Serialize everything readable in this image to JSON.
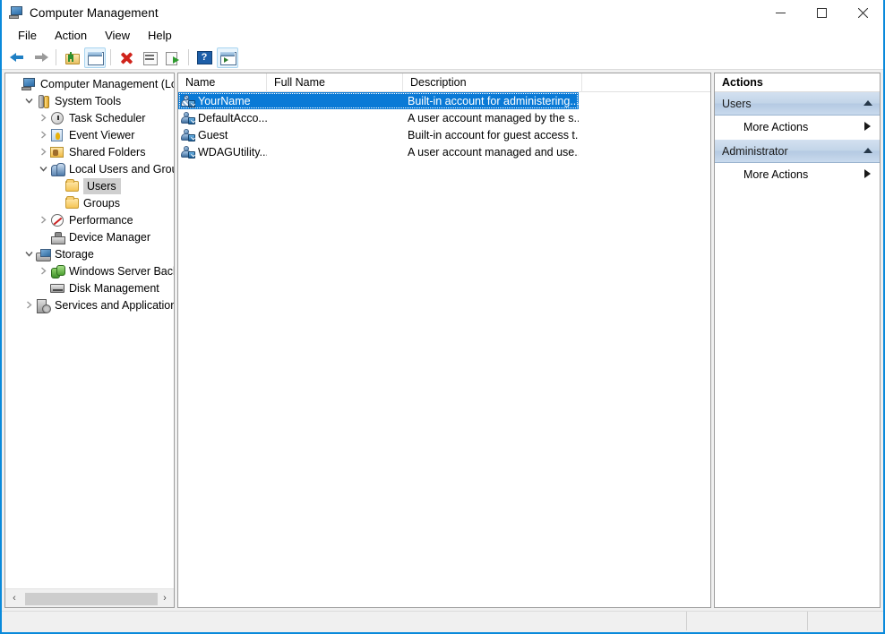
{
  "window": {
    "title": "Computer Management",
    "icon": "computer-management-icon",
    "minimize_label": "–",
    "maximize_label": "□",
    "close_label": "✕"
  },
  "menubar": {
    "items": [
      {
        "label": "File"
      },
      {
        "label": "Action"
      },
      {
        "label": "View"
      },
      {
        "label": "Help"
      }
    ]
  },
  "toolbar": {
    "buttons": [
      {
        "name": "back-button",
        "icon": "back-arrow-icon",
        "framed": false
      },
      {
        "name": "forward-button",
        "icon": "forward-arrow-icon",
        "framed": false
      },
      {
        "name": "up-one-level-button",
        "icon": "up-folder-icon",
        "framed": false
      },
      {
        "name": "show-hide-tree-button",
        "icon": "console-tree-icon",
        "framed": true
      },
      {
        "name": "delete-button",
        "icon": "delete-x-icon",
        "framed": false
      },
      {
        "name": "properties-button",
        "icon": "properties-icon",
        "framed": false
      },
      {
        "name": "export-list-button",
        "icon": "export-list-icon",
        "framed": false
      },
      {
        "name": "help-button",
        "icon": "help-question-icon",
        "framed": true
      },
      {
        "name": "show-action-pane-button",
        "icon": "action-pane-icon",
        "framed": true
      }
    ]
  },
  "tree": {
    "nodes": [
      {
        "label": "Computer Management (Local",
        "icon": "computer-icon",
        "indent": 0,
        "chevron": "",
        "selected": false
      },
      {
        "label": "System Tools",
        "icon": "system-tools-icon",
        "indent": 1,
        "chevron": "v",
        "selected": false
      },
      {
        "label": "Task Scheduler",
        "icon": "task-scheduler-icon",
        "indent": 2,
        "chevron": ">",
        "selected": false
      },
      {
        "label": "Event Viewer",
        "icon": "event-viewer-icon",
        "indent": 2,
        "chevron": ">",
        "selected": false
      },
      {
        "label": "Shared Folders",
        "icon": "shared-folders-icon",
        "indent": 2,
        "chevron": ">",
        "selected": false
      },
      {
        "label": "Local Users and Groups",
        "icon": "local-users-icon",
        "indent": 2,
        "chevron": "v",
        "selected": false
      },
      {
        "label": "Users",
        "icon": "folder-icon",
        "indent": 3,
        "chevron": "",
        "selected": true
      },
      {
        "label": "Groups",
        "icon": "folder-icon",
        "indent": 3,
        "chevron": "",
        "selected": false
      },
      {
        "label": "Performance",
        "icon": "performance-icon",
        "indent": 2,
        "chevron": ">",
        "selected": false
      },
      {
        "label": "Device Manager",
        "icon": "device-manager-icon",
        "indent": 2,
        "chevron": "",
        "selected": false
      },
      {
        "label": "Storage",
        "icon": "storage-icon",
        "indent": 1,
        "chevron": "v",
        "selected": false
      },
      {
        "label": "Windows Server Backup",
        "icon": "server-backup-icon",
        "indent": 2,
        "chevron": ">",
        "selected": false
      },
      {
        "label": "Disk Management",
        "icon": "disk-management-icon",
        "indent": 2,
        "chevron": "",
        "selected": false
      },
      {
        "label": "Services and Applications",
        "icon": "services-icon",
        "indent": 1,
        "chevron": ">",
        "selected": false
      }
    ],
    "hscroll": {
      "left_arrow": "‹",
      "right_arrow": "›"
    }
  },
  "list": {
    "columns": [
      {
        "label": "Name"
      },
      {
        "label": "Full Name"
      },
      {
        "label": "Description"
      }
    ],
    "rows": [
      {
        "name": "YourName",
        "full_name": "",
        "description": "Built-in account for administering...",
        "icon": "administrator-account-icon",
        "selected": true
      },
      {
        "name": "DefaultAcco...",
        "full_name": "",
        "description": "A user account managed by the s...",
        "icon": "user-account-icon",
        "selected": false
      },
      {
        "name": "Guest",
        "full_name": "",
        "description": "Built-in account for guest access t...",
        "icon": "user-account-icon",
        "selected": false
      },
      {
        "name": "WDAGUtility...",
        "full_name": "",
        "description": "A user account managed and use...",
        "icon": "user-account-icon",
        "selected": false
      }
    ]
  },
  "actions": {
    "title": "Actions",
    "groups": [
      {
        "header": "Users",
        "collapse_caret": "▲",
        "items": [
          {
            "label": "More Actions",
            "arrow": "▶"
          }
        ]
      },
      {
        "header": "Administrator",
        "collapse_caret": "▲",
        "items": [
          {
            "label": "More Actions",
            "arrow": "▶"
          }
        ]
      }
    ]
  },
  "statusbar": {
    "cells": [
      "",
      "",
      ""
    ]
  },
  "colors": {
    "selection_blue": "#0a7ad6",
    "window_border": "#0a8adb",
    "tree_selection_gray": "#cfcfcf",
    "actions_header": "#c2d4e8",
    "chrome_bg": "#f0f0f0"
  }
}
